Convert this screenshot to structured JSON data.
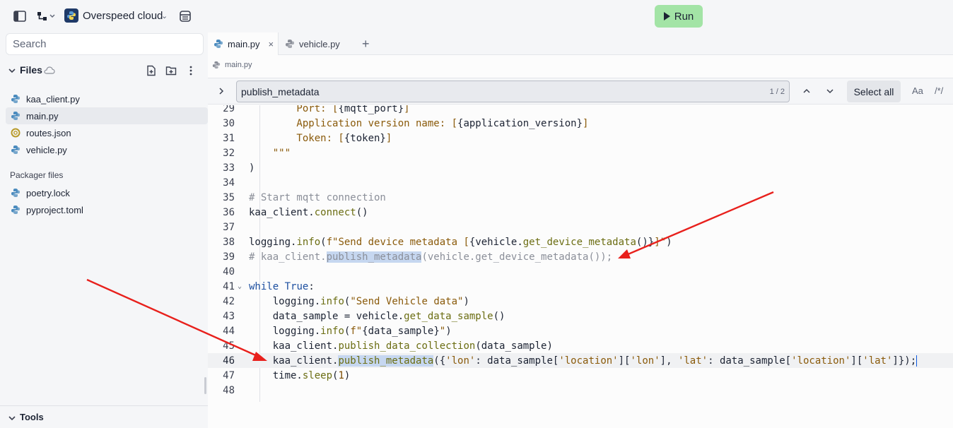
{
  "topbar": {
    "repl_name": "Overspeed cloud",
    "run_label": "Run"
  },
  "sidebar": {
    "search_placeholder": "Search",
    "files_title": "Files",
    "files": [
      {
        "name": "kaa_client.py",
        "icon": "python-icon"
      },
      {
        "name": "main.py",
        "icon": "python-icon",
        "active": true
      },
      {
        "name": "routes.json",
        "icon": "json-icon"
      },
      {
        "name": "vehicle.py",
        "icon": "python-icon"
      }
    ],
    "packager_label": "Packager files",
    "packager_files": [
      {
        "name": "poetry.lock",
        "icon": "python-icon"
      },
      {
        "name": "pyproject.toml",
        "icon": "python-icon"
      }
    ],
    "tools_label": "Tools"
  },
  "editor": {
    "tabs": [
      {
        "label": "main.py",
        "active": true
      },
      {
        "label": "vehicle.py",
        "active": false
      }
    ],
    "breadcrumb": "main.py",
    "find": {
      "query": "publish_metadata",
      "count": "1 / 2",
      "select_all": "Select all",
      "case_option": "Aa",
      "regex_option": "/*/"
    },
    "active_line": "46",
    "code_lines": [
      {
        "n": "29",
        "text": "        Port: [{mqtt_port}]"
      },
      {
        "n": "30",
        "text": "        Application version name: [{application_version}]"
      },
      {
        "n": "31",
        "text": "        Token: [{token}]"
      },
      {
        "n": "32",
        "text": "    \"\"\""
      },
      {
        "n": "33",
        "text": ")"
      },
      {
        "n": "34",
        "text": ""
      },
      {
        "n": "35",
        "text": "# Start mqtt connection"
      },
      {
        "n": "36",
        "text": "kaa_client.connect()"
      },
      {
        "n": "37",
        "text": ""
      },
      {
        "n": "38",
        "text": "logging.info(f\"Send device metadata [{vehicle.get_device_metadata()}]\")"
      },
      {
        "n": "39",
        "text": "# kaa_client.publish_metadata(vehicle.get_device_metadata());"
      },
      {
        "n": "40",
        "text": ""
      },
      {
        "n": "41",
        "text": "while True:"
      },
      {
        "n": "42",
        "text": "    logging.info(\"Send Vehicle data\")"
      },
      {
        "n": "43",
        "text": "    data_sample = vehicle.get_data_sample()"
      },
      {
        "n": "44",
        "text": "    logging.info(f\"{data_sample}\")"
      },
      {
        "n": "45",
        "text": "    kaa_client.publish_data_collection(data_sample)"
      },
      {
        "n": "46",
        "text": "    kaa_client.publish_metadata({'lon': data_sample['location']['lon'], 'lat': data_sample['location']['lat']});"
      },
      {
        "n": "47",
        "text": "    time.sleep(1)"
      },
      {
        "n": "48",
        "text": ""
      }
    ]
  },
  "colors": {
    "run_button": "#a3e4a6",
    "search_highlight": "#c6d7f0",
    "annotation_arrow": "#e8201c"
  }
}
